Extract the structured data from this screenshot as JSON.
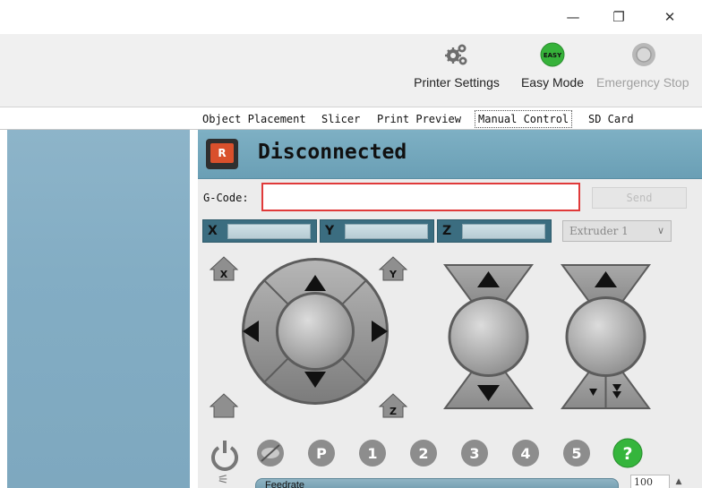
{
  "window": {
    "minimize_glyph": "—",
    "restore_glyph": "❐",
    "close_glyph": "✕"
  },
  "toolbar": {
    "printer_settings_label": "Printer Settings",
    "easy_mode_label": "Easy Mode",
    "easy_mode_badge": "EASY",
    "emergency_stop_label": "Emergency Stop"
  },
  "tabs": [
    {
      "label": "Object Placement"
    },
    {
      "label": "Slicer"
    },
    {
      "label": "Print Preview"
    },
    {
      "label": "Manual Control",
      "active": true
    },
    {
      "label": "SD Card"
    }
  ],
  "manual_control": {
    "status_title": "Disconnected",
    "logo_letter": "R",
    "gcode_label": "G-Code:",
    "gcode_value": "",
    "send_label": "Send",
    "coords": [
      {
        "axis": "X",
        "value": ""
      },
      {
        "axis": "Y",
        "value": ""
      },
      {
        "axis": "Z",
        "value": ""
      }
    ],
    "extruder_selected": "Extruder 1",
    "home_labels": {
      "x": "X",
      "y": "Y",
      "z": "Z"
    },
    "button_digits": [
      "1",
      "2",
      "3",
      "4",
      "5"
    ],
    "p_label": "P",
    "help_label": "?",
    "feedrate_label": "Feedrate",
    "feedrate_value": "100"
  },
  "colors": {
    "accent_blue": "#6a9fb5",
    "easy_green": "#36b23a",
    "help_green": "#35b53c",
    "gcode_border": "#e03a3a",
    "button_gray": "#9a9a9a"
  }
}
